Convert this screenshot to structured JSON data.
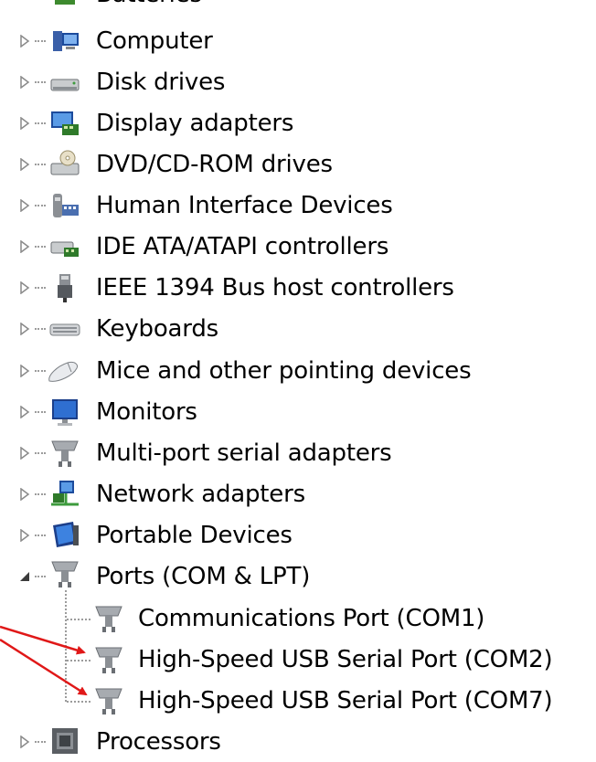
{
  "device_tree": {
    "categories": [
      {
        "label": "Batteries",
        "icon": "battery-icon",
        "state": "collapsed"
      },
      {
        "label": "Computer",
        "icon": "computer-icon",
        "state": "collapsed"
      },
      {
        "label": "Disk drives",
        "icon": "disk-drive-icon",
        "state": "collapsed"
      },
      {
        "label": "Display adapters",
        "icon": "display-adapter-icon",
        "state": "collapsed"
      },
      {
        "label": "DVD/CD-ROM drives",
        "icon": "dvd-drive-icon",
        "state": "collapsed"
      },
      {
        "label": "Human Interface Devices",
        "icon": "hid-icon",
        "state": "collapsed"
      },
      {
        "label": "IDE ATA/ATAPI controllers",
        "icon": "ide-controller-icon",
        "state": "collapsed"
      },
      {
        "label": "IEEE 1394 Bus host controllers",
        "icon": "firewire-icon",
        "state": "collapsed"
      },
      {
        "label": "Keyboards",
        "icon": "keyboard-icon",
        "state": "collapsed"
      },
      {
        "label": "Mice and other pointing devices",
        "icon": "mouse-icon",
        "state": "collapsed"
      },
      {
        "label": "Monitors",
        "icon": "monitor-icon",
        "state": "collapsed"
      },
      {
        "label": "Multi-port serial adapters",
        "icon": "serial-port-icon",
        "state": "collapsed"
      },
      {
        "label": "Network adapters",
        "icon": "network-adapter-icon",
        "state": "collapsed"
      },
      {
        "label": "Portable Devices",
        "icon": "portable-device-icon",
        "state": "collapsed"
      },
      {
        "label": "Ports (COM & LPT)",
        "icon": "port-icon",
        "state": "expanded"
      },
      {
        "label": "Processors",
        "icon": "processor-icon",
        "state": "collapsed"
      }
    ],
    "ports_children": [
      {
        "label": "Communications Port (COM1)",
        "icon": "port-icon"
      },
      {
        "label": "High-Speed USB Serial Port (COM2)",
        "icon": "port-icon"
      },
      {
        "label": "High-Speed USB Serial Port (COM7)",
        "icon": "port-icon"
      }
    ]
  },
  "colors": {
    "annotation_arrow": "#e01818",
    "connector_line": "#9c9c9c",
    "expander": "#8a8a8a"
  }
}
